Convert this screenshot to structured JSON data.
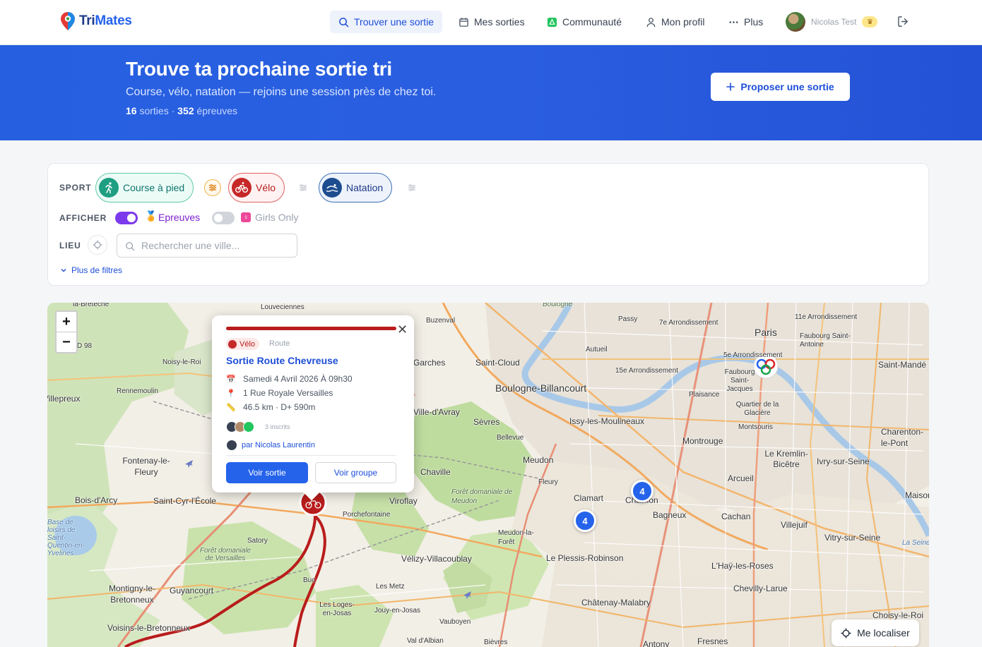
{
  "nav": {
    "brand_a": "Tri",
    "brand_b": "Mates",
    "items": [
      {
        "label": "Trouver une sortie",
        "icon": "search-icon"
      },
      {
        "label": "Mes sorties",
        "icon": "calendar-icon"
      },
      {
        "label": "Communauté",
        "icon": "community-icon"
      },
      {
        "label": "Mon profil",
        "icon": "user-icon"
      },
      {
        "label": "Plus",
        "icon": "more-icon"
      }
    ],
    "user_name": "Nicolas Test",
    "user_badge": "crown-icon"
  },
  "hero": {
    "title": "Trouve ta prochaine sortie tri",
    "subtitle": "Course, vélo, natation — rejoins une session près de chez toi.",
    "stats_count_a": "16",
    "stats_label_a": "sorties ·",
    "stats_count_b": "352",
    "stats_label_b": "épreuves",
    "propose_label": "Proposer une sortie"
  },
  "filters": {
    "sport_label": "SPORT",
    "sports": [
      "Course à pied",
      "Vélo",
      "Natation"
    ],
    "show_label": "AFFICHER",
    "epreuves_label": "Epreuves",
    "epreuves_on": true,
    "girls_label": "Girls Only",
    "girls_on": false,
    "place_label": "LIEU",
    "search_placeholder": "Rechercher une ville...",
    "more_filters": "Plus de filtres"
  },
  "map": {
    "labels": [
      "la-Bretèche",
      "Louveciennes",
      "Buzenval",
      "Boulogne",
      "Passy",
      "7e Arrondissement",
      "11e Arrondissement",
      "D 98",
      "Noisy-le-Roi",
      "Rennemoulin",
      "Villepreux",
      "Garches",
      "Saint-Cloud",
      "Autueil",
      "Paris",
      "Faubourg Saint-Antoine",
      "Saint-Mandé",
      "15e Arrondissement",
      "5e Arrondissement",
      "Faubourg Saint-Jacques",
      "Boulogne-Billancourt",
      "Plaisance",
      "Quartier de la Glacière",
      "Ville-d'Avray",
      "Sèvres",
      "Issy-les-Moulineaux",
      "Montsouris",
      "Charenton-le-Pont",
      "Bellevue",
      "Montrouge",
      "Le Kremlin-Bicêtre",
      "Ivry-sur-Seine",
      "Fontenay-le-Fleury",
      "Meudon",
      "Chaville",
      "Fleury",
      "Arcueil",
      "Forêt domaniale de Meudon",
      "Bois-d'Arcy",
      "Saint-Cyr-l'École",
      "Viroflay",
      "Clamart",
      "Châtillon",
      "Bagneux",
      "Cachan",
      "Villejuif",
      "Porchefontaine",
      "Meudon-la-Forêt",
      "Vitry-sur-Seine",
      "Satory",
      "Vélizy-Villacoublay",
      "Le Plessis-Robinson",
      "L'Haÿ-les-Roses",
      "Forêt domaniale de Versailles",
      "Buc",
      "Les Metz",
      "Chevilly-Larue",
      "Montigny-le-Bretonneux",
      "Guyancourt",
      "Châtenay-Malabry",
      "Les Loges-en-Josas",
      "Jouy-en-Josas",
      "Vauboyen",
      "Voisins-le-Bretonneux",
      "Val d'Albian",
      "Bièvres",
      "Antony",
      "Fresnes",
      "Choisy-le-Roi",
      "Maisons",
      "La Seine",
      "Base de loisirs de Saint-Quentin-en-Yvelines"
    ],
    "clusters": [
      "4",
      "4"
    ],
    "zoom_in": "+",
    "zoom_out": "−",
    "locate_label": "Me localiser"
  },
  "popup": {
    "sport_tag": "Vélo",
    "sport_sub": "Route",
    "title": "Sortie Route Chevreuse",
    "date": "Samedi 4 Avril 2026 À 09h30",
    "address": "1 Rue Royale Versailles",
    "distance": "46.5 km · D+ 590m",
    "registered": "3 inscrits",
    "organizer": "par Nicolas Laurentin",
    "btn_primary": "Voir sortie",
    "btn_secondary": "Voir groupe"
  }
}
